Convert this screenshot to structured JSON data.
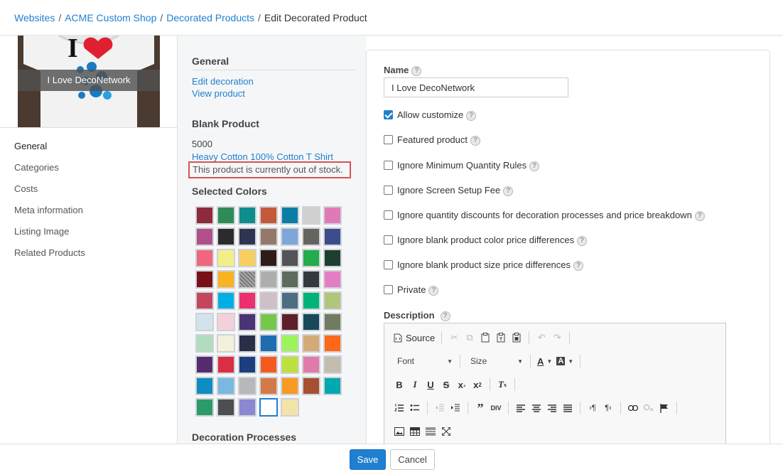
{
  "breadcrumb": {
    "items": [
      "Websites",
      "ACME Custom Shop",
      "Decorated Products"
    ],
    "current": "Edit Decorated Product"
  },
  "product_thumb": {
    "label": "I Love DecoNetwork",
    "logo_text": "I"
  },
  "sidebar": {
    "items": [
      {
        "label": "General",
        "active": true
      },
      {
        "label": "Categories"
      },
      {
        "label": "Costs"
      },
      {
        "label": "Meta information"
      },
      {
        "label": "Listing Image"
      },
      {
        "label": "Related Products"
      }
    ]
  },
  "middle": {
    "general_heading": "General",
    "edit_decoration": "Edit decoration",
    "view_product": "View product",
    "blank_heading": "Blank Product",
    "product_code": "5000",
    "product_name": "Heavy Cotton 100% Cotton T Shirt",
    "stock_notice": "This product is currently out of stock.",
    "colors_heading": "Selected Colors",
    "colors": [
      "#8e2a3c",
      "#2e8b57",
      "#0f8c8c",
      "#c4593a",
      "#0b7ea8",
      "#d0d0d0",
      "#e07ab7",
      "#b04f8a",
      "#2b2b2e",
      "#2f3450",
      "#94786a",
      "#7ea6d8",
      "#666460",
      "#3c4d8e",
      "#f0667e",
      "#f2ef8a",
      "#f6cf5e",
      "#2e1c18",
      "#545458",
      "#23ab4e",
      "#1e3f30",
      "#7a0f18",
      "#f7b322",
      "#8b8b8b",
      "#aeaeae",
      "#5d6b5e",
      "#33393e",
      "#e47ec4",
      "#c4465e",
      "#00aee6",
      "#ec2f6e",
      "#cec0c6",
      "#4d6d80",
      "#00b37a",
      "#b0c67a",
      "#d3e3ec",
      "#f5d0da",
      "#4a3474",
      "#77c84a",
      "#5e1f2a",
      "#17495a",
      "#717b62",
      "#b0dcc0",
      "#f5f0dc",
      "#2a2e48",
      "#1e6db0",
      "#9df35a",
      "#d4aa78",
      "#fc6818",
      "#572c6e",
      "#d92e44",
      "#1c3d7e",
      "#f45a1e",
      "#bde03c",
      "#e07aaa",
      "#c3bcaf",
      "#0d8dc2",
      "#7ab8e0",
      "#b8b8bc",
      "#d47a48",
      "#f79a26",
      "#a65032",
      "#00a8b0",
      "#2b9b6a",
      "#4d4e52",
      "#8a88d0",
      "#ffffff",
      "#f2e4a8"
    ],
    "processes_heading": "Decoration Processes"
  },
  "form": {
    "name_label": "Name",
    "name_value": "I Love DecoNetwork",
    "checkboxes": [
      {
        "label": "Allow customize",
        "checked": true
      },
      {
        "label": "Featured product",
        "checked": false
      },
      {
        "label": "Ignore Minimum Quantity Rules",
        "checked": false
      },
      {
        "label": "Ignore Screen Setup Fee",
        "checked": false
      },
      {
        "label": "Ignore quantity discounts for decoration processes and price breakdown",
        "checked": false
      },
      {
        "label": "Ignore blank product color price differences",
        "checked": false
      },
      {
        "label": "Ignore blank product size price differences",
        "checked": false
      },
      {
        "label": "Private",
        "checked": false
      }
    ],
    "description_label": "Description",
    "help_glyph": "?"
  },
  "editor": {
    "source_label": "Source",
    "font_label": "Font",
    "size_label": "Size"
  },
  "footer": {
    "save": "Save",
    "cancel": "Cancel"
  }
}
